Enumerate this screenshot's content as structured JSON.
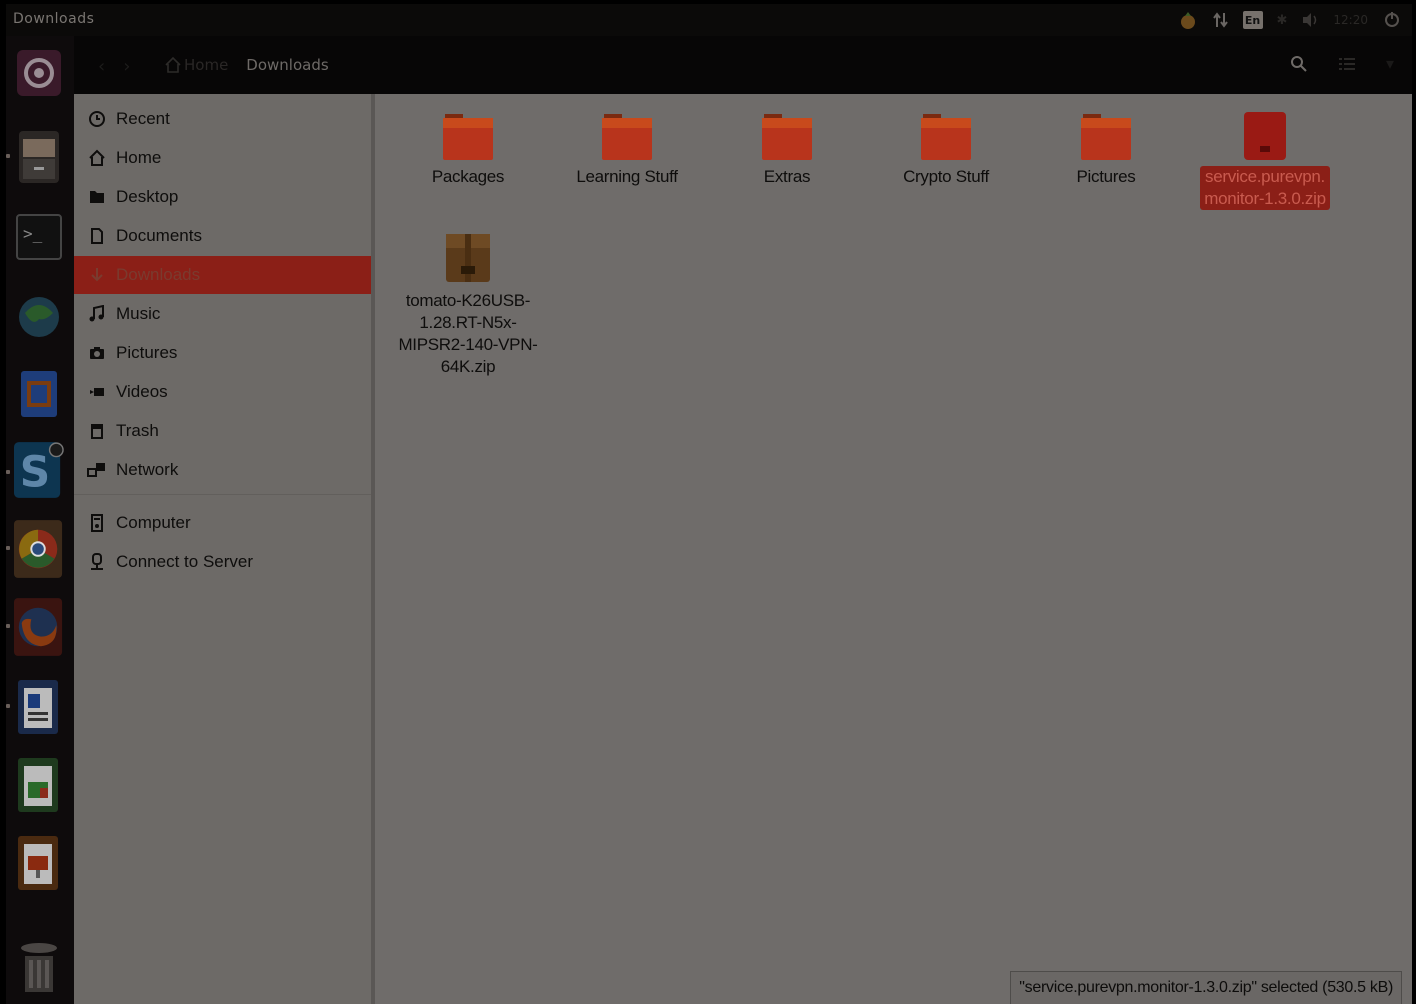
{
  "top_panel": {
    "title": "Downloads",
    "clock": "12:20"
  },
  "header": {
    "breadcrumb_home": "Home",
    "breadcrumb_current": "Downloads"
  },
  "sidebar": {
    "items": [
      {
        "label": "Recent",
        "icon": "clock-icon"
      },
      {
        "label": "Home",
        "icon": "home-icon"
      },
      {
        "label": "Desktop",
        "icon": "folder-icon"
      },
      {
        "label": "Documents",
        "icon": "document-icon"
      },
      {
        "label": "Downloads",
        "icon": "download-icon",
        "active": true
      },
      {
        "label": "Music",
        "icon": "music-icon"
      },
      {
        "label": "Pictures",
        "icon": "camera-icon"
      },
      {
        "label": "Videos",
        "icon": "video-icon"
      },
      {
        "label": "Trash",
        "icon": "trash-icon"
      },
      {
        "label": "Network",
        "icon": "network-icon"
      }
    ],
    "devices": [
      {
        "label": "Computer",
        "icon": "computer-icon"
      },
      {
        "label": "Connect to Server",
        "icon": "server-icon"
      }
    ]
  },
  "files": [
    {
      "name": "Packages",
      "type": "folder"
    },
    {
      "name": "Learning Stuff",
      "type": "folder"
    },
    {
      "name": "Extras",
      "type": "folder"
    },
    {
      "name": "Crypto Stuff",
      "type": "folder"
    },
    {
      "name": "Pictures",
      "type": "folder"
    },
    {
      "name_line1": "service.purevpn.",
      "name_line2": "monitor-1.3.0.zip",
      "type": "zip",
      "selected": true
    },
    {
      "name_line1": "tomato-K26USB-",
      "name_line2": "1.28.RT-N5x-",
      "name_line3": "MIPSR2-140-VPN-",
      "name_line4": "64K.zip",
      "type": "archive"
    }
  ],
  "status": {
    "text": "\"service.purevpn.monitor-1.3.0.zip\" selected  (530.5 kB)"
  },
  "colors": {
    "accent": "#8b1f17",
    "folder": "#b8341c",
    "sidebar_bg": "#6d6a67",
    "content_bg": "#6f6c6a"
  }
}
